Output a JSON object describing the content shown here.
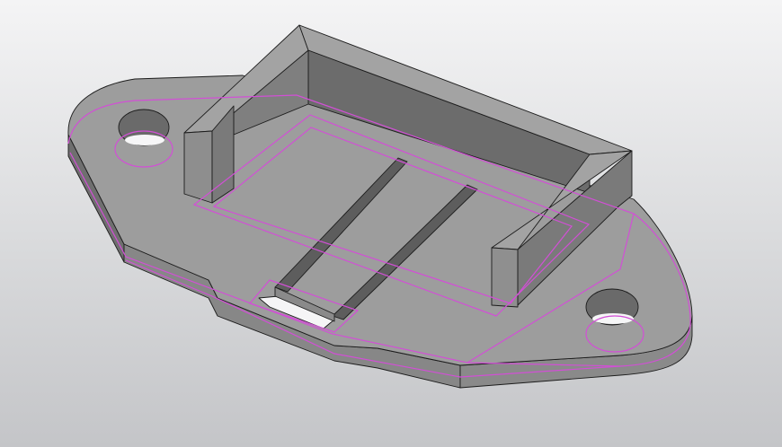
{
  "scene": {
    "kind": "3d-cad-viewport",
    "object": "bracket-plate-with-two-mounting-holes",
    "colors": {
      "background_top": "#f4f4f5",
      "background_bottom": "#c4c5c8",
      "top_face": "#9d9d9d",
      "side_face_light": "#858585",
      "side_face_dark": "#6e6e6e",
      "wall_inner": "#6f6f6f",
      "edge": "#1c1c1c",
      "highlight": "#d24fd6"
    }
  }
}
